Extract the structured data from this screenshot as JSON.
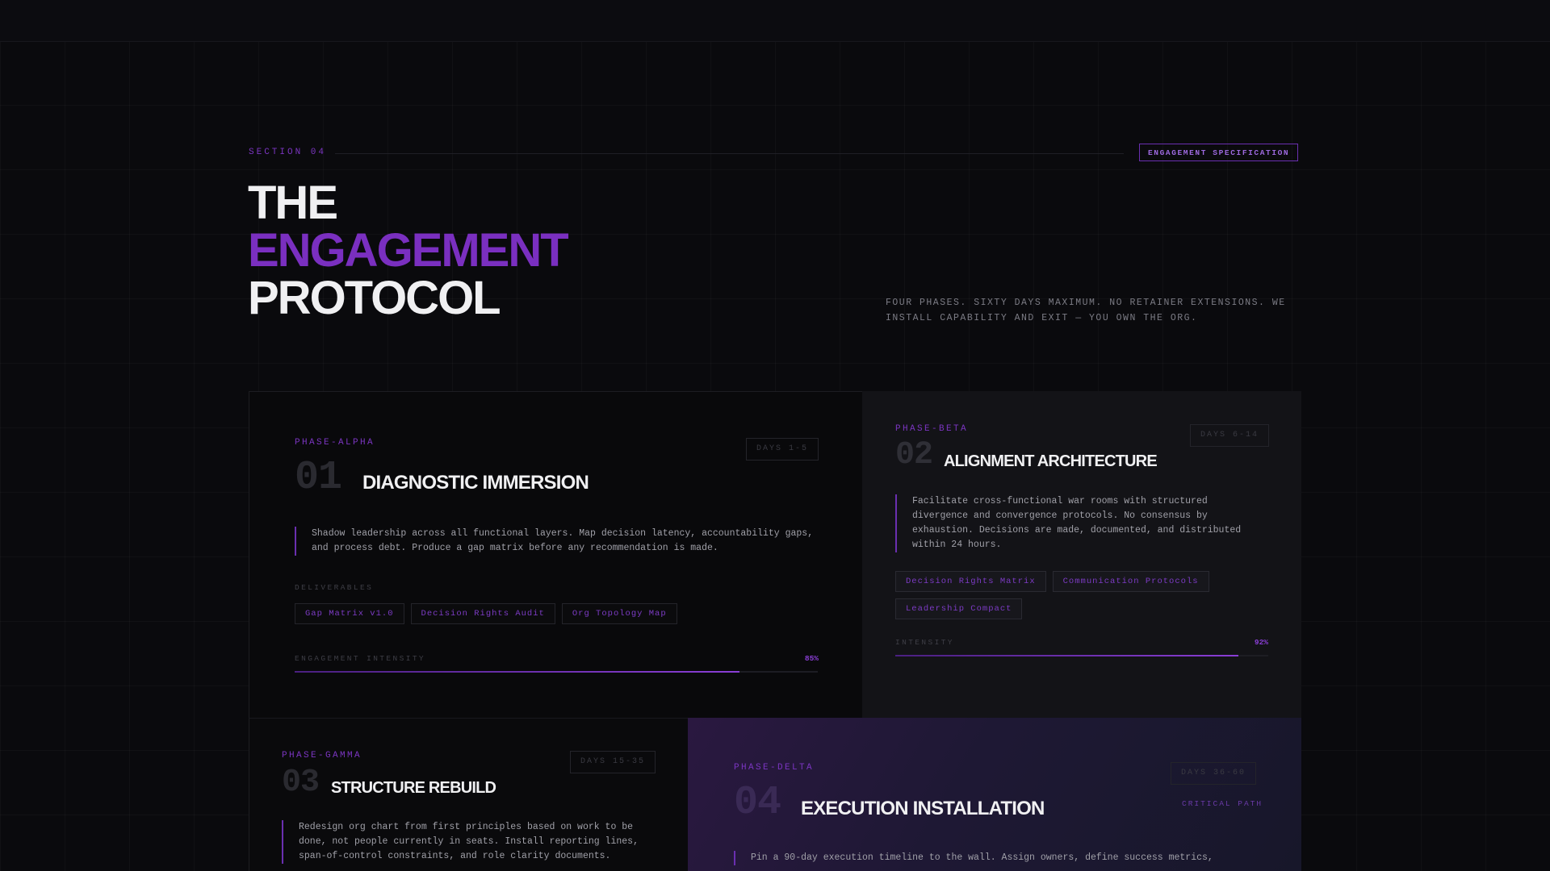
{
  "header": {
    "section_label": "SECTION 04",
    "badge": "ENGAGEMENT SPECIFICATION"
  },
  "hero": {
    "title_line1": "THE",
    "title_line2": "ENGAGEMENT",
    "title_line3": "PROTOCOL",
    "description": "FOUR PHASES. SIXTY DAYS MAXIMUM. NO RETAINER EXTENSIONS. WE INSTALL CAPABILITY AND EXIT — YOU OWN THE ORG."
  },
  "colors": {
    "accent": "#7a2fc0",
    "background": "#0a0a0d",
    "text": "#f0f0f2"
  },
  "phases": [
    {
      "tag": "PHASE-ALPHA",
      "number": "01",
      "title": "DIAGNOSTIC IMMERSION",
      "days": "DAYS 1-5",
      "description": "Shadow leadership across all functional layers. Map decision latency, accountability gaps, and process debt. Produce a gap matrix before any recommendation is made.",
      "deliverables_label": "DELIVERABLES",
      "deliverables": [
        "Gap Matrix v1.0",
        "Decision Rights Audit",
        "Org Topology Map"
      ],
      "intensity_label": "ENGAGEMENT INTENSITY",
      "intensity_value": "85%",
      "intensity_fraction": 0.85
    },
    {
      "tag": "PHASE-BETA",
      "number": "02",
      "title": "ALIGNMENT ARCHITECTURE",
      "days": "DAYS 6-14",
      "description": "Facilitate cross-functional war rooms with structured divergence and convergence protocols. No consensus by exhaustion. Decisions are made, documented, and distributed within 24 hours.",
      "deliverables": [
        "Decision Rights Matrix",
        "Communication Protocols",
        "Leadership Compact"
      ],
      "intensity_label": "INTENSITY",
      "intensity_value": "92%",
      "intensity_fraction": 0.92
    },
    {
      "tag": "PHASE-GAMMA",
      "number": "03",
      "title": "STRUCTURE REBUILD",
      "days": "DAYS 15-35",
      "description": "Redesign org chart from first principles based on work to be done, not people currently in seats. Install reporting lines, span-of-control constraints, and role clarity documents."
    },
    {
      "tag": "PHASE-DELTA",
      "number": "04",
      "title": "EXECUTION INSTALLATION",
      "days": "DAYS 36-60",
      "critical": "CRITICAL PATH",
      "description": "Pin a 90-day execution timeline to the wall. Assign owners, define success metrics,"
    }
  ]
}
